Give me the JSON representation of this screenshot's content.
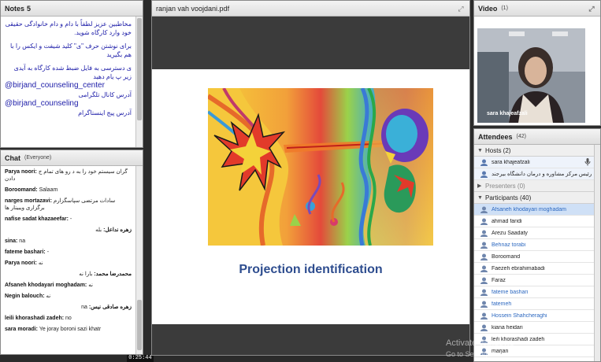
{
  "notes": {
    "title": "Notes",
    "count": "5",
    "lines": [
      "مخاطبین عزیز لطفاً با دام و دام خانوادگی حقیقی خود وارد کارگاه شوید.",
      "برای نوشتن حرف \"ی\" کلید شیفت و ایکس را با هم بگیرید",
      "ی دسترسی به فایل ضبط شده کارگاه به آیدی زیر پ یام دهید"
    ],
    "link_a": "@birjand_counseling_center",
    "label_a": "آدرس کانال تلگرامی",
    "link_b": "@birjand_counseling",
    "label_b": "آدرس پیج اینستاگرام"
  },
  "chat": {
    "title": "Chat",
    "scope": "(Everyone)",
    "messages": [
      {
        "who": "Parya noori:",
        "text": "گران سیستم خود را به د رو های تمام ج دادن",
        "rtl": false
      },
      {
        "who": "Boroomand:",
        "text": "Salaam",
        "rtl": false
      },
      {
        "who": "narges mortazavi:",
        "text": "سادات مرتضی سپاسگزارم برگزاری ویبینار ها",
        "rtl": false
      },
      {
        "who": "nafise sadat khazaeefar:",
        "text": "-",
        "rtl": false
      },
      {
        "who": "زهره نداعل:",
        "text": "بله",
        "rtl": true
      },
      {
        "who": "sina:",
        "text": "na",
        "rtl": false
      },
      {
        "who": "fateme bashari:",
        "text": "-",
        "rtl": false
      },
      {
        "who": "Parya noori:",
        "text": "نه",
        "rtl": false
      },
      {
        "who": "محمدرضا محمد:",
        "text": "بارا نه",
        "rtl": true
      },
      {
        "who": "Afsaneh khodayari moghadam:",
        "text": "نه",
        "rtl": false
      },
      {
        "who": "Negin balouch:",
        "text": "نه",
        "rtl": false
      },
      {
        "who": "زهره صادقی نیس:",
        "text": "na",
        "rtl": true
      },
      {
        "who": "leili khorashadi zadeh:",
        "text": "no",
        "rtl": false
      },
      {
        "who": "sara moradi:",
        "text": "Ye joray boroni sazi khatr",
        "rtl": false
      }
    ],
    "timer": "0:25:44"
  },
  "share": {
    "filename": "ranjan vah voojdani.pdf",
    "caption": "Projection identification"
  },
  "video": {
    "title": "Video",
    "count": "(1)",
    "presenter_name": "sara khajeafzali"
  },
  "attendees": {
    "title": "Attendees",
    "count": "(42)",
    "hosts_label": "Hosts (2)",
    "hosts": [
      "sara khajeafzali",
      "رئیس مرکز مشاوره و درمان دانشگاه بیرجند"
    ],
    "presenters_label": "Presenters (0)",
    "participants_label": "Participants (40)",
    "participants": [
      {
        "name": "Afsaneh khodayari moghadam",
        "blue": true
      },
      {
        "name": "ahmad faridi",
        "blue": false
      },
      {
        "name": "Arezu Saadaty",
        "blue": false
      },
      {
        "name": "Behnaz torabi",
        "blue": true
      },
      {
        "name": "Boroomand",
        "blue": false
      },
      {
        "name": "Faezeh ebrahimabadi",
        "blue": false
      },
      {
        "name": "Faraz",
        "blue": false
      },
      {
        "name": "fateme bashari",
        "blue": true
      },
      {
        "name": "fatemeh",
        "blue": true
      },
      {
        "name": "Hossein Shahcheraghi",
        "blue": true
      },
      {
        "name": "kiana heidari",
        "blue": false
      },
      {
        "name": "leili khorashadi zadeh",
        "blue": false
      },
      {
        "name": "marjan",
        "blue": false
      }
    ]
  },
  "watermark": {
    "line1": "Activate Windows",
    "line2": "Go to Settings to activate Windows."
  }
}
